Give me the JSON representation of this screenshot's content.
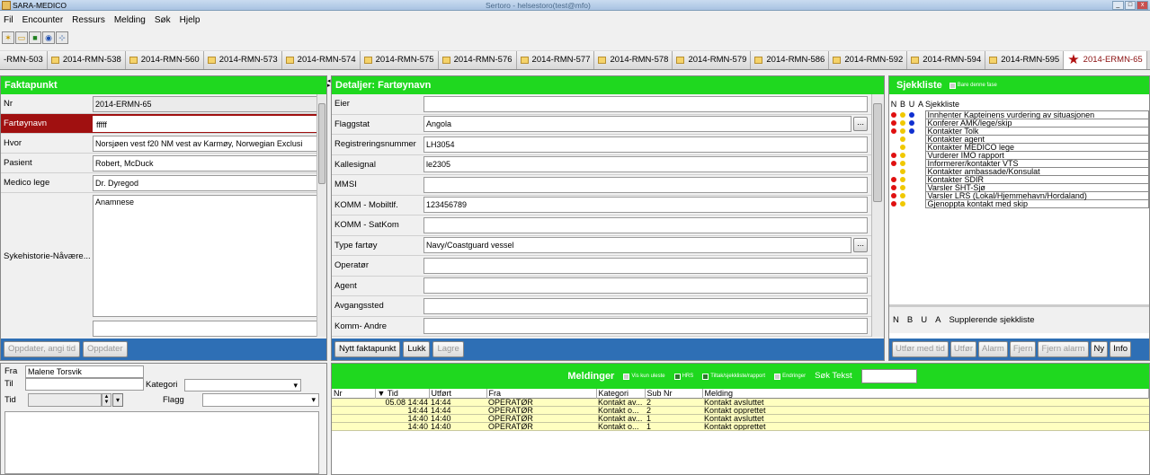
{
  "window": {
    "title": "SARA-MEDICO",
    "center_text": "Sertoro - helsestoro(test@mfo)"
  },
  "menu": [
    "Fil",
    "Encounter",
    "Ressurs",
    "Melding",
    "Søk",
    "Hjelp"
  ],
  "tabs": [
    "-RMN-503",
    "2014-RMN-538",
    "2014-RMN-560",
    "2014-RMN-573",
    "2014-RMN-574",
    "2014-RMN-575",
    "2014-RMN-576",
    "2014-RMN-577",
    "2014-RMN-578",
    "2014-RMN-579",
    "2014-RMN-586",
    "2014-RMN-592",
    "2014-RMN-594",
    "2014-RMN-595"
  ],
  "active_tab": "2014-ERMN-65",
  "faktapunkt": {
    "title": "Faktapunkt",
    "rows": [
      {
        "label": "Nr",
        "value": "2014-ERMN-65"
      },
      {
        "label": "Fartøynavn",
        "value": "fffff"
      },
      {
        "label": "Hvor",
        "value": "Norsjøen vest f20 NM vest av Karmøy, Norwegian Exclusi"
      },
      {
        "label": "Pasient",
        "value": "Robert, McDuck"
      },
      {
        "label": "Medico lege",
        "value": "Dr. Dyregod"
      }
    ],
    "history_label": "Sykehistorie-Nåvære...",
    "history_text": "Anamnese",
    "buttons": [
      "Oppdater, angi tid",
      "Oppdater"
    ]
  },
  "detaljer": {
    "title": "Detaljer: Fartøynavn",
    "rows": [
      {
        "label": "Eier",
        "value": ""
      },
      {
        "label": "Flaggstat",
        "value": "Angola"
      },
      {
        "label": "Registreringsnummer",
        "value": "LH3054"
      },
      {
        "label": "Kallesignal",
        "value": "le2305"
      },
      {
        "label": "MMSI",
        "value": ""
      },
      {
        "label": "KOMM - Mobiltlf.",
        "value": "123456789"
      },
      {
        "label": "KOMM - SatKom",
        "value": ""
      },
      {
        "label": "Type fartøy",
        "value": "Navy/Coastguard vessel"
      },
      {
        "label": "Operatør",
        "value": ""
      },
      {
        "label": "Agent",
        "value": ""
      },
      {
        "label": "Avgangssted",
        "value": ""
      },
      {
        "label": "Komm- Andre",
        "value": ""
      }
    ],
    "browse_label": "...",
    "buttons": [
      "Nytt faktapunkt",
      "Lukk",
      "Lagre"
    ]
  },
  "sjekkliste": {
    "title": "Sjekkliste",
    "only_phase": "Bare denne fase",
    "cols": [
      "N",
      "B",
      "U",
      "A",
      "Sjekkliste"
    ],
    "items": [
      {
        "text": "Innhenter Kapteinens vurdering av situasjonen",
        "n": "r",
        "b": "y",
        "u": "b"
      },
      {
        "text": "Konferer AMK/lege/skip",
        "n": "r",
        "b": "y",
        "u": "b"
      },
      {
        "text": "Kontakter Tolk",
        "n": "r",
        "b": "y",
        "u": "b"
      },
      {
        "text": "Kontakter agent",
        "n": "",
        "b": "y",
        "u": ""
      },
      {
        "text": "Kontakter MEDICO lege",
        "n": "",
        "b": "y",
        "u": ""
      },
      {
        "text": "Vurderer IMO rapport",
        "n": "r",
        "b": "y",
        "u": ""
      },
      {
        "text": "Informerer/kontakter VTS",
        "n": "r",
        "b": "y",
        "u": ""
      },
      {
        "text": "Kontakter ambassade/Konsulat",
        "n": "",
        "b": "y",
        "u": ""
      },
      {
        "text": "Kontakter SDIR",
        "n": "r",
        "b": "y",
        "u": ""
      },
      {
        "text": "Varsler SHT-Sjø",
        "n": "r",
        "b": "y",
        "u": ""
      },
      {
        "text": "Varsler LRS (Lokal/Hjemmehavn/Hordaland)",
        "n": "r",
        "b": "y",
        "u": ""
      },
      {
        "text": "Gjenoppta kontakt med skip",
        "n": "r",
        "b": "y",
        "u": ""
      }
    ],
    "supp_cols": [
      "N",
      "B",
      "U",
      "A",
      "Supplerende sjekkliste"
    ],
    "buttons": [
      "Utfør med tid",
      "Utfør",
      "Alarm",
      "Fjern",
      "Fjern alarm",
      "Ny",
      "Info"
    ]
  },
  "compose": {
    "fra_label": "Fra",
    "fra_value": "Malene Torsvik",
    "til_label": "Til",
    "kategori_label": "Kategori",
    "tid_label": "Tid",
    "flagg_label": "Flagg"
  },
  "meldinger": {
    "title": "Meldinger",
    "filters": [
      "Vis kun uleste",
      "HRS",
      "Tiltak/sjekkliste/rapport",
      "Endringer"
    ],
    "sok_label": "Søk Tekst",
    "cols": [
      "Nr",
      "▼ Tid",
      "Utført",
      "Fra",
      "Kategori",
      "Sub Nr",
      "Melding"
    ],
    "rows": [
      [
        "",
        "05.08 14:44",
        "14:44",
        "OPERATØR",
        "Kontakt av...",
        "2",
        "Kontakt avsluttet"
      ],
      [
        "",
        "14:44",
        "14:44",
        "OPERATØR",
        "Kontakt o...",
        "2",
        "Kontakt opprettet"
      ],
      [
        "",
        "14:40",
        "14:40",
        "OPERATØR",
        "Kontakt av...",
        "1",
        "Kontakt avsluttet"
      ],
      [
        "",
        "14:40",
        "14:40",
        "OPERATØR",
        "Kontakt o...",
        "1",
        "Kontakt opprettet"
      ]
    ]
  }
}
